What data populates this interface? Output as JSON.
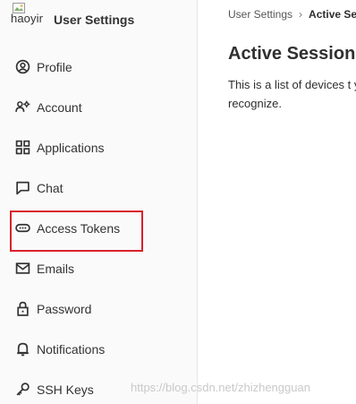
{
  "header": {
    "avatar_alt": "haoyin",
    "title": "User Settings"
  },
  "sidebar": {
    "items": [
      {
        "label": "Profile",
        "icon": "profile-icon"
      },
      {
        "label": "Account",
        "icon": "account-icon"
      },
      {
        "label": "Applications",
        "icon": "applications-icon"
      },
      {
        "label": "Chat",
        "icon": "chat-icon"
      },
      {
        "label": "Access Tokens",
        "icon": "access-tokens-icon",
        "highlighted": true
      },
      {
        "label": "Emails",
        "icon": "emails-icon"
      },
      {
        "label": "Password",
        "icon": "lock-icon"
      },
      {
        "label": "Notifications",
        "icon": "bell-icon"
      },
      {
        "label": "SSH Keys",
        "icon": "key-icon"
      }
    ]
  },
  "breadcrumb": {
    "parent": "User Settings",
    "separator": "›",
    "current": "Active Ses"
  },
  "main": {
    "title": "Active Sessions",
    "description": "This is a list of devices t your account. Revoke a not recognize."
  },
  "watermark": "https://blog.csdn.net/zhizhengguan",
  "colors": {
    "highlight_border": "#d9222a",
    "sidebar_bg": "#fafafa"
  }
}
